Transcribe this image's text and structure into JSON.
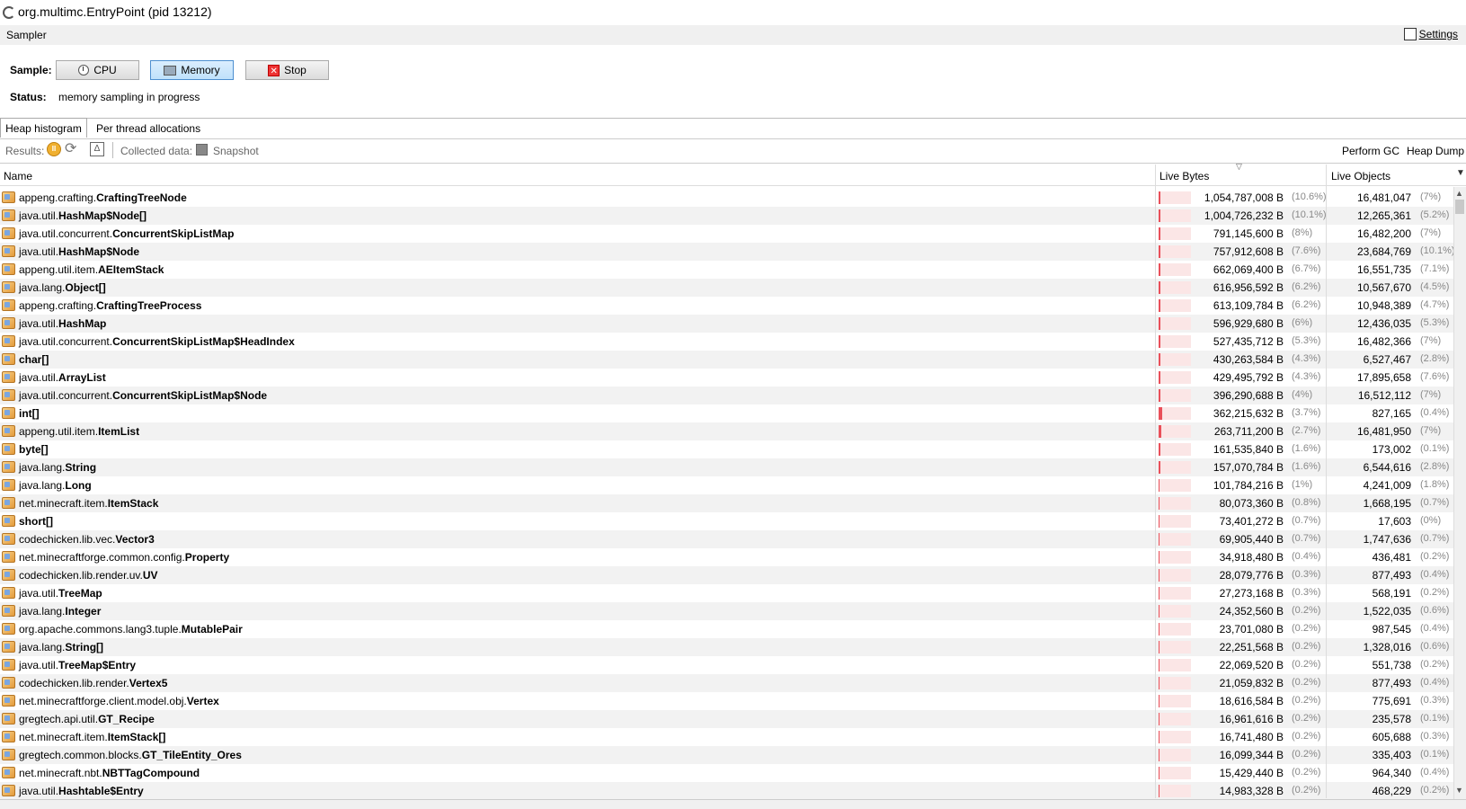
{
  "window": {
    "title_main": "org.multimc.EntryPoint",
    "title_pid": "(pid 13212)"
  },
  "sampler": {
    "section_label": "Sampler",
    "settings_label": "Settings",
    "sample_label": "Sample:",
    "buttons": {
      "cpu": "CPU",
      "memory": "Memory",
      "stop": "Stop"
    },
    "active_mode": "memory",
    "status_label": "Status:",
    "status_value": "memory sampling in progress"
  },
  "tabs": {
    "heap": "Heap histogram",
    "thread": "Per thread allocations",
    "active": "heap"
  },
  "toolbar": {
    "results_label": "Results:",
    "collected_label": "Collected data:",
    "snapshot_label": "Snapshot",
    "gc_label": "Perform GC",
    "dump_label": "Heap Dump"
  },
  "table": {
    "columns": {
      "name": "Name",
      "bytes": "Live Bytes",
      "objects": "Live Objects"
    },
    "sort_column": "bytes",
    "rows": [
      {
        "pkg": "appeng.crafting.",
        "cls": "CraftingTreeNode",
        "bytes": "1,054,787,008 B",
        "bytes_pct": "(10.6%)",
        "objs": "16,481,047",
        "objs_pct": "(7%)",
        "frac": 10.6
      },
      {
        "pkg": "java.util.",
        "cls": "HashMap$Node[]",
        "bytes": "1,004,726,232 B",
        "bytes_pct": "(10.1%)",
        "objs": "12,265,361",
        "objs_pct": "(5.2%)",
        "frac": 10.1
      },
      {
        "pkg": "java.util.concurrent.",
        "cls": "ConcurrentSkipListMap",
        "bytes": "791,145,600 B",
        "bytes_pct": "(8%)",
        "objs": "16,482,200",
        "objs_pct": "(7%)",
        "frac": 8
      },
      {
        "pkg": "java.util.",
        "cls": "HashMap$Node",
        "bytes": "757,912,608 B",
        "bytes_pct": "(7.6%)",
        "objs": "23,684,769",
        "objs_pct": "(10.1%)",
        "frac": 7.6
      },
      {
        "pkg": "appeng.util.item.",
        "cls": "AEItemStack",
        "bytes": "662,069,400 B",
        "bytes_pct": "(6.7%)",
        "objs": "16,551,735",
        "objs_pct": "(7.1%)",
        "frac": 6.7
      },
      {
        "pkg": "java.lang.",
        "cls": "Object[]",
        "bytes": "616,956,592 B",
        "bytes_pct": "(6.2%)",
        "objs": "10,567,670",
        "objs_pct": "(4.5%)",
        "frac": 6.2
      },
      {
        "pkg": "appeng.crafting.",
        "cls": "CraftingTreeProcess",
        "bytes": "613,109,784 B",
        "bytes_pct": "(6.2%)",
        "objs": "10,948,389",
        "objs_pct": "(4.7%)",
        "frac": 6.2
      },
      {
        "pkg": "java.util.",
        "cls": "HashMap",
        "bytes": "596,929,680 B",
        "bytes_pct": "(6%)",
        "objs": "12,436,035",
        "objs_pct": "(5.3%)",
        "frac": 6
      },
      {
        "pkg": "java.util.concurrent.",
        "cls": "ConcurrentSkipListMap$HeadIndex",
        "bytes": "527,435,712 B",
        "bytes_pct": "(5.3%)",
        "objs": "16,482,366",
        "objs_pct": "(7%)",
        "frac": 5.3
      },
      {
        "pkg": "",
        "cls": "char[]",
        "bytes": "430,263,584 B",
        "bytes_pct": "(4.3%)",
        "objs": "6,527,467",
        "objs_pct": "(2.8%)",
        "frac": 4.3
      },
      {
        "pkg": "java.util.",
        "cls": "ArrayList",
        "bytes": "429,495,792 B",
        "bytes_pct": "(4.3%)",
        "objs": "17,895,658",
        "objs_pct": "(7.6%)",
        "frac": 4.3
      },
      {
        "pkg": "java.util.concurrent.",
        "cls": "ConcurrentSkipListMap$Node",
        "bytes": "396,290,688 B",
        "bytes_pct": "(4%)",
        "objs": "16,512,112",
        "objs_pct": "(7%)",
        "frac": 4
      },
      {
        "pkg": "",
        "cls": "int[]",
        "bytes": "362,215,632 B",
        "bytes_pct": "(3.7%)",
        "objs": "827,165",
        "objs_pct": "(0.4%)",
        "frac": 3.7
      },
      {
        "pkg": "appeng.util.item.",
        "cls": "ItemList",
        "bytes": "263,711,200 B",
        "bytes_pct": "(2.7%)",
        "objs": "16,481,950",
        "objs_pct": "(7%)",
        "frac": 2.7
      },
      {
        "pkg": "",
        "cls": "byte[]",
        "bytes": "161,535,840 B",
        "bytes_pct": "(1.6%)",
        "objs": "173,002",
        "objs_pct": "(0.1%)",
        "frac": 1.6
      },
      {
        "pkg": "java.lang.",
        "cls": "String",
        "bytes": "157,070,784 B",
        "bytes_pct": "(1.6%)",
        "objs": "6,544,616",
        "objs_pct": "(2.8%)",
        "frac": 1.6
      },
      {
        "pkg": "java.lang.",
        "cls": "Long",
        "bytes": "101,784,216 B",
        "bytes_pct": "(1%)",
        "objs": "4,241,009",
        "objs_pct": "(1.8%)",
        "frac": 1
      },
      {
        "pkg": "net.minecraft.item.",
        "cls": "ItemStack",
        "bytes": "80,073,360 B",
        "bytes_pct": "(0.8%)",
        "objs": "1,668,195",
        "objs_pct": "(0.7%)",
        "frac": 0.8
      },
      {
        "pkg": "",
        "cls": "short[]",
        "bytes": "73,401,272 B",
        "bytes_pct": "(0.7%)",
        "objs": "17,603",
        "objs_pct": "(0%)",
        "frac": 0.7
      },
      {
        "pkg": "codechicken.lib.vec.",
        "cls": "Vector3",
        "bytes": "69,905,440 B",
        "bytes_pct": "(0.7%)",
        "objs": "1,747,636",
        "objs_pct": "(0.7%)",
        "frac": 0.7
      },
      {
        "pkg": "net.minecraftforge.common.config.",
        "cls": "Property",
        "bytes": "34,918,480 B",
        "bytes_pct": "(0.4%)",
        "objs": "436,481",
        "objs_pct": "(0.2%)",
        "frac": 0.4
      },
      {
        "pkg": "codechicken.lib.render.uv.",
        "cls": "UV",
        "bytes": "28,079,776 B",
        "bytes_pct": "(0.3%)",
        "objs": "877,493",
        "objs_pct": "(0.4%)",
        "frac": 0.3
      },
      {
        "pkg": "java.util.",
        "cls": "TreeMap",
        "bytes": "27,273,168 B",
        "bytes_pct": "(0.3%)",
        "objs": "568,191",
        "objs_pct": "(0.2%)",
        "frac": 0.3
      },
      {
        "pkg": "java.lang.",
        "cls": "Integer",
        "bytes": "24,352,560 B",
        "bytes_pct": "(0.2%)",
        "objs": "1,522,035",
        "objs_pct": "(0.6%)",
        "frac": 0.2
      },
      {
        "pkg": "org.apache.commons.lang3.tuple.",
        "cls": "MutablePair",
        "bytes": "23,701,080 B",
        "bytes_pct": "(0.2%)",
        "objs": "987,545",
        "objs_pct": "(0.4%)",
        "frac": 0.2
      },
      {
        "pkg": "java.lang.",
        "cls": "String[]",
        "bytes": "22,251,568 B",
        "bytes_pct": "(0.2%)",
        "objs": "1,328,016",
        "objs_pct": "(0.6%)",
        "frac": 0.2
      },
      {
        "pkg": "java.util.",
        "cls": "TreeMap$Entry",
        "bytes": "22,069,520 B",
        "bytes_pct": "(0.2%)",
        "objs": "551,738",
        "objs_pct": "(0.2%)",
        "frac": 0.2
      },
      {
        "pkg": "codechicken.lib.render.",
        "cls": "Vertex5",
        "bytes": "21,059,832 B",
        "bytes_pct": "(0.2%)",
        "objs": "877,493",
        "objs_pct": "(0.4%)",
        "frac": 0.2
      },
      {
        "pkg": "net.minecraftforge.client.model.obj.",
        "cls": "Vertex",
        "bytes": "18,616,584 B",
        "bytes_pct": "(0.2%)",
        "objs": "775,691",
        "objs_pct": "(0.3%)",
        "frac": 0.2
      },
      {
        "pkg": "gregtech.api.util.",
        "cls": "GT_Recipe",
        "bytes": "16,961,616 B",
        "bytes_pct": "(0.2%)",
        "objs": "235,578",
        "objs_pct": "(0.1%)",
        "frac": 0.2
      },
      {
        "pkg": "net.minecraft.item.",
        "cls": "ItemStack[]",
        "bytes": "16,741,480 B",
        "bytes_pct": "(0.2%)",
        "objs": "605,688",
        "objs_pct": "(0.3%)",
        "frac": 0.2
      },
      {
        "pkg": "gregtech.common.blocks.",
        "cls": "GT_TileEntity_Ores",
        "bytes": "16,099,344 B",
        "bytes_pct": "(0.2%)",
        "objs": "335,403",
        "objs_pct": "(0.1%)",
        "frac": 0.2
      },
      {
        "pkg": "net.minecraft.nbt.",
        "cls": "NBTTagCompound",
        "bytes": "15,429,440 B",
        "bytes_pct": "(0.2%)",
        "objs": "964,340",
        "objs_pct": "(0.4%)",
        "frac": 0.2
      },
      {
        "pkg": "java.util.",
        "cls": "Hashtable$Entry",
        "bytes": "14,983,328 B",
        "bytes_pct": "(0.2%)",
        "objs": "468,229",
        "objs_pct": "(0.2%)",
        "frac": 0.2
      }
    ]
  }
}
